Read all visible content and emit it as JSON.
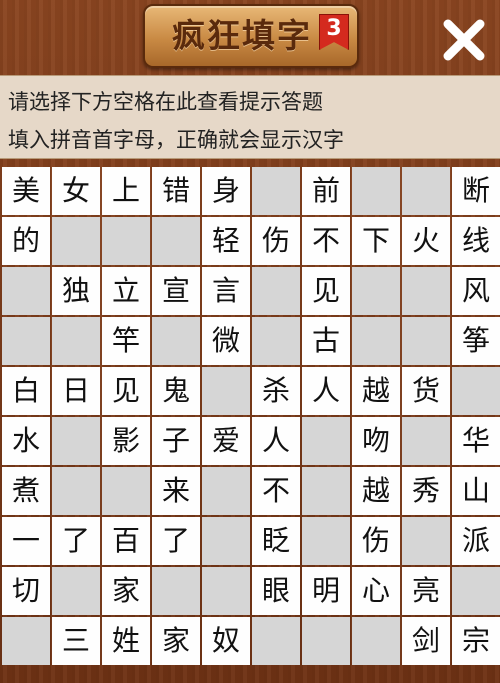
{
  "header": {
    "title": "疯狂填字",
    "level": "3"
  },
  "hints": {
    "line1": "请选择下方空格在此查看提示答题",
    "line2": "填入拼音首字母，正确就会显示汉字"
  },
  "grid": [
    [
      "美",
      "女",
      "上",
      "错",
      "身",
      "#",
      "前",
      "#",
      "#",
      "断"
    ],
    [
      "的",
      "#",
      "#",
      "#",
      "轻",
      "伤",
      "不",
      "下",
      "火",
      "线"
    ],
    [
      "#",
      "独",
      "立",
      "宣",
      "言",
      "#",
      "见",
      "#",
      "#",
      "风"
    ],
    [
      "#",
      "#",
      "竿",
      "#",
      "微",
      "#",
      "古",
      "#",
      "#",
      "筝"
    ],
    [
      "白",
      "日",
      "见",
      "鬼",
      "#",
      "杀",
      "人",
      "越",
      "货",
      "#"
    ],
    [
      "水",
      "#",
      "影",
      "子",
      "爱",
      "人",
      "#",
      "吻",
      "#",
      "华"
    ],
    [
      "煮",
      "#",
      "#",
      "来",
      "#",
      "不",
      "#",
      "越",
      "秀",
      "山"
    ],
    [
      "一",
      "了",
      "百",
      "了",
      "#",
      "眨",
      "#",
      "伤",
      "#",
      "派"
    ],
    [
      "切",
      "#",
      "家",
      "#",
      "#",
      "眼",
      "明",
      "心",
      "亮",
      "#"
    ],
    [
      "#",
      "三",
      "姓",
      "家",
      "奴",
      "#",
      "#",
      "#",
      "剑",
      "宗"
    ]
  ],
  "icons": {
    "close": "close-icon"
  },
  "colors": {
    "wood": "#7a3a18",
    "cell_filled": "#fefefe",
    "cell_empty": "#d6d6d6",
    "ribbon": "#d42a1e"
  }
}
